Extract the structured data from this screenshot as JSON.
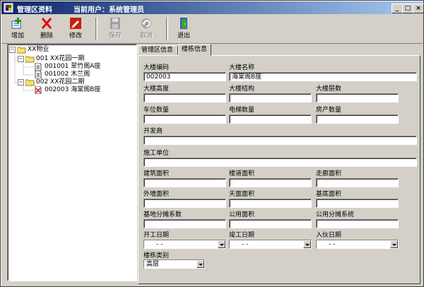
{
  "window": {
    "title": "管理区资料",
    "user_label": "当前用户：系统管理员",
    "controls": {
      "minimize": "_",
      "maximize": "□",
      "close": "×"
    }
  },
  "toolbar": {
    "add": "增加",
    "delete": "删除",
    "edit": "修改",
    "save": "保存",
    "cancel": "取消",
    "exit": "退出"
  },
  "tree": {
    "root": "XX物业",
    "items": [
      {
        "label": "001 XX花园一期"
      },
      {
        "label": "001001 翠竹阁A座"
      },
      {
        "label": "001002 木兰阁"
      },
      {
        "label": "002 XX花园二期"
      },
      {
        "label": "002003 海棠阁B座"
      }
    ]
  },
  "tabs": [
    {
      "label": "管理区信息"
    },
    {
      "label": "楼栋信息"
    }
  ],
  "form": {
    "building_code": {
      "label": "大楼编码",
      "value": "002003"
    },
    "building_name": {
      "label": "大楼名称",
      "value": "海棠阁B座"
    },
    "building_height": {
      "label": "大楼高度",
      "value": ""
    },
    "building_structure": {
      "label": "大楼结构",
      "value": ""
    },
    "building_floors": {
      "label": "大楼层数",
      "value": ""
    },
    "parking_count": {
      "label": "车位数量",
      "value": ""
    },
    "elevator_count": {
      "label": "电梯数量",
      "value": ""
    },
    "property_count": {
      "label": "房产数量",
      "value": ""
    },
    "developer": {
      "label": "开发商",
      "value": ""
    },
    "contractor": {
      "label": "施工单位",
      "value": ""
    },
    "building_area": {
      "label": "建筑面积",
      "value": ""
    },
    "corridor_area": {
      "label": "楼道面积",
      "value": ""
    },
    "hallway_area": {
      "label": "走廊面积",
      "value": ""
    },
    "exterior_wall_area": {
      "label": "外墙面积",
      "value": ""
    },
    "roof_area": {
      "label": "天面面积",
      "value": ""
    },
    "base_area": {
      "label": "基底面积",
      "value": ""
    },
    "land_share_coef": {
      "label": "基地分摊系数",
      "value": ""
    },
    "public_area": {
      "label": "公用面积",
      "value": ""
    },
    "public_share_coef": {
      "label": "公用分摊系统",
      "value": ""
    },
    "start_date": {
      "label": "开工日期",
      "value": "-   -"
    },
    "completion_date": {
      "label": "竣工日期",
      "value": "-   -"
    },
    "move_in_date": {
      "label": "入伙日期",
      "value": "-   -"
    },
    "building_type": {
      "label": "楼栋类别",
      "value": "高层"
    }
  }
}
